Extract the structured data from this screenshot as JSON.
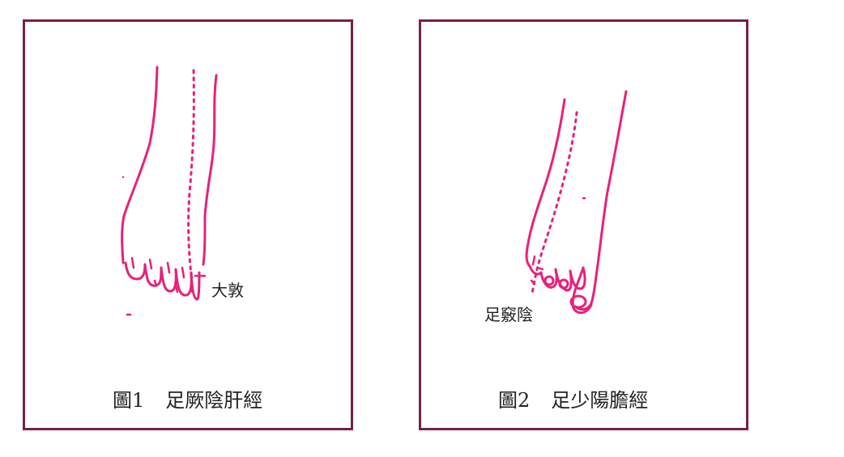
{
  "colors": {
    "frame": "#7a1f47",
    "meridian": "#e8207a",
    "text": "#222222"
  },
  "figures": [
    {
      "number": "圖1",
      "title": "足厥陰肝經",
      "point_label": "大敦"
    },
    {
      "number": "圖2",
      "title": "足少陽膽經",
      "point_label": "足竅陰"
    }
  ]
}
